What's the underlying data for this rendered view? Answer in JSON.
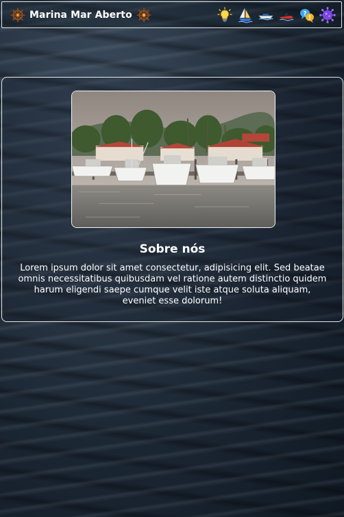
{
  "navbar": {
    "brand_title": "Marina Mar Aberto",
    "icons": [
      "ship-wheel-icon",
      "lightbulb-icon",
      "sailboat-icon",
      "motorboat-icon",
      "jetski-icon",
      "help-chat-icon",
      "virus-icon",
      "ship-wheel-icon"
    ]
  },
  "about": {
    "title": "Sobre nós",
    "text": "Lorem ipsum dolor sit amet consectetur, adipisicing elit. Sed beatae omnis necessitatibus quibusdam vel ratione autem distinctio quidem harum eligendi saepe cumque velit iste atque soluta aliquam, eveniet esse dolorum!"
  },
  "colors": {
    "border": "#e8e8e8",
    "text": "#ffffff",
    "ocean": "#1b2633"
  }
}
